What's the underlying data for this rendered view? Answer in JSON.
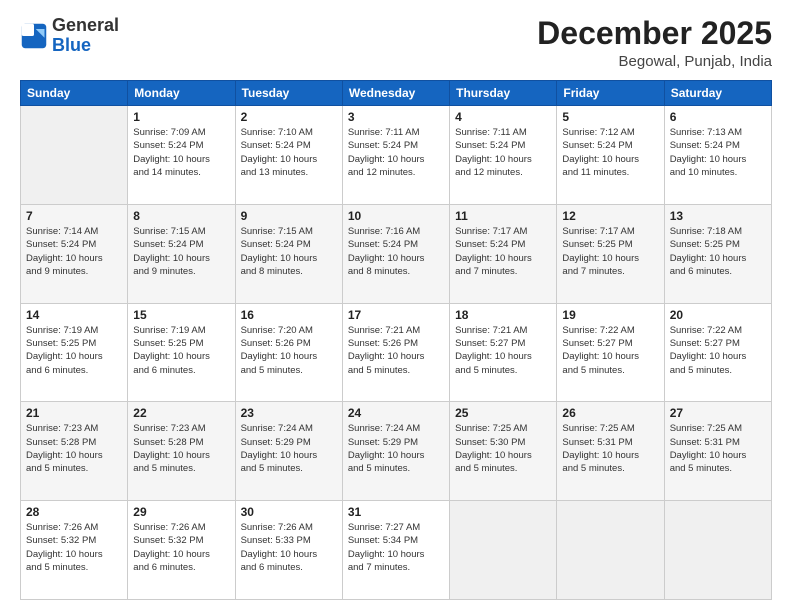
{
  "header": {
    "logo_general": "General",
    "logo_blue": "Blue",
    "month_title": "December 2025",
    "location": "Begowal, Punjab, India"
  },
  "days_of_week": [
    "Sunday",
    "Monday",
    "Tuesday",
    "Wednesday",
    "Thursday",
    "Friday",
    "Saturday"
  ],
  "weeks": [
    [
      {
        "day": "",
        "info": ""
      },
      {
        "day": "1",
        "info": "Sunrise: 7:09 AM\nSunset: 5:24 PM\nDaylight: 10 hours\nand 14 minutes."
      },
      {
        "day": "2",
        "info": "Sunrise: 7:10 AM\nSunset: 5:24 PM\nDaylight: 10 hours\nand 13 minutes."
      },
      {
        "day": "3",
        "info": "Sunrise: 7:11 AM\nSunset: 5:24 PM\nDaylight: 10 hours\nand 12 minutes."
      },
      {
        "day": "4",
        "info": "Sunrise: 7:11 AM\nSunset: 5:24 PM\nDaylight: 10 hours\nand 12 minutes."
      },
      {
        "day": "5",
        "info": "Sunrise: 7:12 AM\nSunset: 5:24 PM\nDaylight: 10 hours\nand 11 minutes."
      },
      {
        "day": "6",
        "info": "Sunrise: 7:13 AM\nSunset: 5:24 PM\nDaylight: 10 hours\nand 10 minutes."
      }
    ],
    [
      {
        "day": "7",
        "info": "Sunrise: 7:14 AM\nSunset: 5:24 PM\nDaylight: 10 hours\nand 9 minutes."
      },
      {
        "day": "8",
        "info": "Sunrise: 7:15 AM\nSunset: 5:24 PM\nDaylight: 10 hours\nand 9 minutes."
      },
      {
        "day": "9",
        "info": "Sunrise: 7:15 AM\nSunset: 5:24 PM\nDaylight: 10 hours\nand 8 minutes."
      },
      {
        "day": "10",
        "info": "Sunrise: 7:16 AM\nSunset: 5:24 PM\nDaylight: 10 hours\nand 8 minutes."
      },
      {
        "day": "11",
        "info": "Sunrise: 7:17 AM\nSunset: 5:24 PM\nDaylight: 10 hours\nand 7 minutes."
      },
      {
        "day": "12",
        "info": "Sunrise: 7:17 AM\nSunset: 5:25 PM\nDaylight: 10 hours\nand 7 minutes."
      },
      {
        "day": "13",
        "info": "Sunrise: 7:18 AM\nSunset: 5:25 PM\nDaylight: 10 hours\nand 6 minutes."
      }
    ],
    [
      {
        "day": "14",
        "info": "Sunrise: 7:19 AM\nSunset: 5:25 PM\nDaylight: 10 hours\nand 6 minutes."
      },
      {
        "day": "15",
        "info": "Sunrise: 7:19 AM\nSunset: 5:25 PM\nDaylight: 10 hours\nand 6 minutes."
      },
      {
        "day": "16",
        "info": "Sunrise: 7:20 AM\nSunset: 5:26 PM\nDaylight: 10 hours\nand 5 minutes."
      },
      {
        "day": "17",
        "info": "Sunrise: 7:21 AM\nSunset: 5:26 PM\nDaylight: 10 hours\nand 5 minutes."
      },
      {
        "day": "18",
        "info": "Sunrise: 7:21 AM\nSunset: 5:27 PM\nDaylight: 10 hours\nand 5 minutes."
      },
      {
        "day": "19",
        "info": "Sunrise: 7:22 AM\nSunset: 5:27 PM\nDaylight: 10 hours\nand 5 minutes."
      },
      {
        "day": "20",
        "info": "Sunrise: 7:22 AM\nSunset: 5:27 PM\nDaylight: 10 hours\nand 5 minutes."
      }
    ],
    [
      {
        "day": "21",
        "info": "Sunrise: 7:23 AM\nSunset: 5:28 PM\nDaylight: 10 hours\nand 5 minutes."
      },
      {
        "day": "22",
        "info": "Sunrise: 7:23 AM\nSunset: 5:28 PM\nDaylight: 10 hours\nand 5 minutes."
      },
      {
        "day": "23",
        "info": "Sunrise: 7:24 AM\nSunset: 5:29 PM\nDaylight: 10 hours\nand 5 minutes."
      },
      {
        "day": "24",
        "info": "Sunrise: 7:24 AM\nSunset: 5:29 PM\nDaylight: 10 hours\nand 5 minutes."
      },
      {
        "day": "25",
        "info": "Sunrise: 7:25 AM\nSunset: 5:30 PM\nDaylight: 10 hours\nand 5 minutes."
      },
      {
        "day": "26",
        "info": "Sunrise: 7:25 AM\nSunset: 5:31 PM\nDaylight: 10 hours\nand 5 minutes."
      },
      {
        "day": "27",
        "info": "Sunrise: 7:25 AM\nSunset: 5:31 PM\nDaylight: 10 hours\nand 5 minutes."
      }
    ],
    [
      {
        "day": "28",
        "info": "Sunrise: 7:26 AM\nSunset: 5:32 PM\nDaylight: 10 hours\nand 5 minutes."
      },
      {
        "day": "29",
        "info": "Sunrise: 7:26 AM\nSunset: 5:32 PM\nDaylight: 10 hours\nand 6 minutes."
      },
      {
        "day": "30",
        "info": "Sunrise: 7:26 AM\nSunset: 5:33 PM\nDaylight: 10 hours\nand 6 minutes."
      },
      {
        "day": "31",
        "info": "Sunrise: 7:27 AM\nSunset: 5:34 PM\nDaylight: 10 hours\nand 7 minutes."
      },
      {
        "day": "",
        "info": ""
      },
      {
        "day": "",
        "info": ""
      },
      {
        "day": "",
        "info": ""
      }
    ]
  ]
}
